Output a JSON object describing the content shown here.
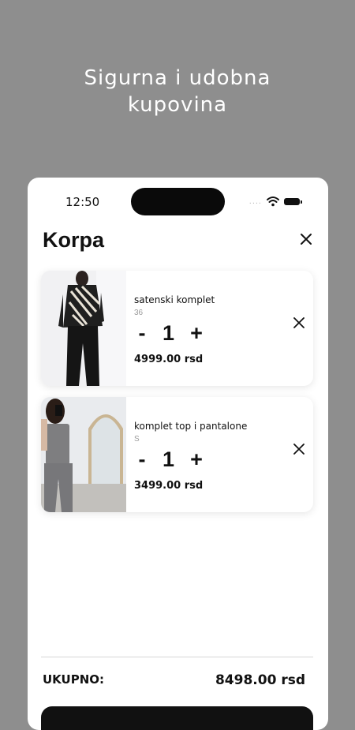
{
  "headline": {
    "line1": "Sigurna i udobna",
    "line2": "kupovina"
  },
  "status_bar": {
    "time": "12:50",
    "signal_dots": "....",
    "icons": [
      "wifi-icon",
      "battery-icon"
    ]
  },
  "cart": {
    "title": "Korpa",
    "close_icon": "close-icon",
    "items": [
      {
        "name": "satenski komplet",
        "size": "36",
        "minus": "-",
        "quantity": "1",
        "plus": "+",
        "price": "4999.00 rsd",
        "remove_icon": "close-icon"
      },
      {
        "name": "komplet top i pantalone",
        "size": "S",
        "minus": "-",
        "quantity": "1",
        "plus": "+",
        "price": "3499.00 rsd",
        "remove_icon": "close-icon"
      }
    ],
    "total_label": "UKUPNO:",
    "total_value": "8498.00 rsd"
  },
  "colors": {
    "background": "#8e8e8e",
    "surface": "#ffffff",
    "text": "#111111",
    "muted": "#9a9a9a"
  }
}
